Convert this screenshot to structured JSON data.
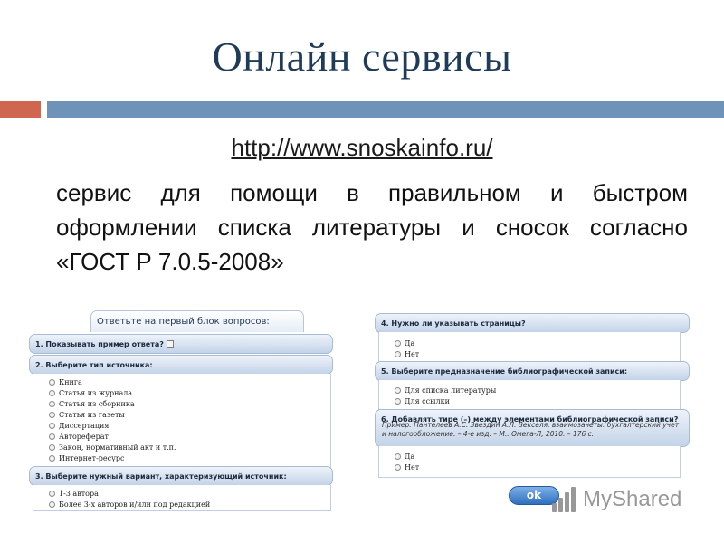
{
  "slide": {
    "title": "Онлайн сервисы",
    "url": "http://www.snoskainfo.ru/",
    "description": "сервис для помощи в правильном и быстром оформлении списка литературы и сносок согласно «ГОСТ Р 7.0.5-2008»"
  },
  "colors": {
    "title": "#1f3b5a",
    "rule_red": "#d0664f",
    "rule_blue": "#6f93b8",
    "ok_button": "#2e6fbf"
  },
  "form_left": {
    "tab": "Ответьте на первый блок вопросов:",
    "q1": "1. Показывать пример ответа?",
    "q2": "2. Выберите тип источника:",
    "q2_options": [
      "Книга",
      "Статья из журнала",
      "Статья из сборника",
      "Статья из газеты",
      "Диссертация",
      "Автореферат",
      "Закон, нормативный акт и т.п.",
      "Интернет-ресурс"
    ],
    "q3": "3. Выберите нужный вариант, характеризующий источник:",
    "q3_options": [
      "1-3 автора",
      "Более 3-х авторов и/или под редакцией"
    ]
  },
  "form_right": {
    "q4": "4. Нужно ли указывать страницы?",
    "q4_options": [
      "Да",
      "Нет"
    ],
    "q5": "5. Выберите предназначение библиографической записи:",
    "q5_options": [
      "Для списка литературы",
      "Для ссылки"
    ],
    "q6": "6. Добавлять тире (–) между элементами библиографической записи?",
    "q6_example": "Пример: Пантелеев А.С. Звездин А.Л. Векселя, взаимозачеты: бухгалтерский учет и налогообложение. – 4-е изд. – М.: Омега-Л, 2010. – 176 с.",
    "q6_options": [
      "Да",
      "Нет"
    ],
    "ok_label": "ok"
  },
  "watermark": {
    "text": "MyShared",
    "icon": "myshared-logo-icon"
  }
}
